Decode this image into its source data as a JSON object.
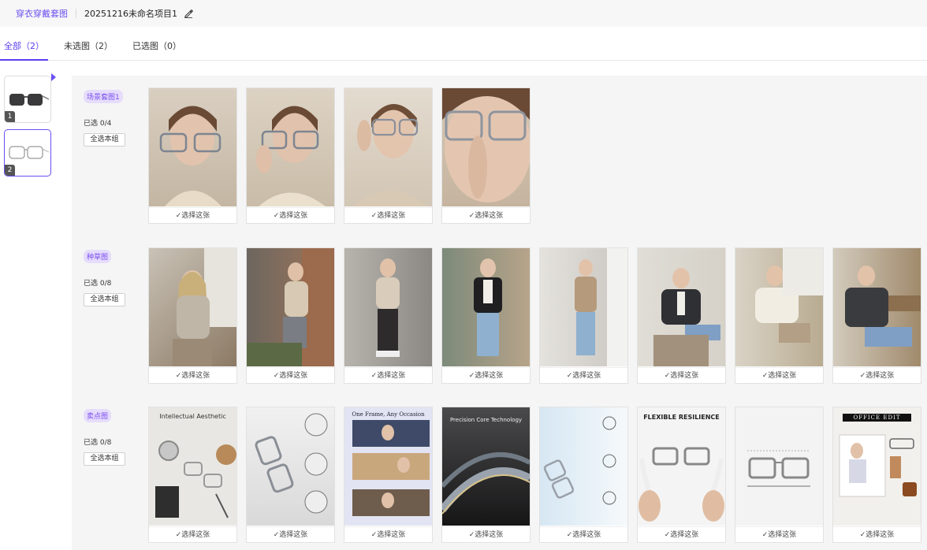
{
  "header": {
    "breadcrumb": "穿衣穿戴套图",
    "project_name": "20251216未命名项目1"
  },
  "tabs": [
    {
      "label": "全部（2）",
      "active": true
    },
    {
      "label": "未选图（2）",
      "active": false
    },
    {
      "label": "已选图（0）",
      "active": false
    }
  ],
  "sidebar": {
    "items": [
      {
        "num": "1"
      },
      {
        "num": "2"
      }
    ]
  },
  "select_label": "✓选择这张",
  "groups": [
    {
      "tag": "场景套图1",
      "count": "已选 0/4",
      "button": "全选本组",
      "cards": 4
    },
    {
      "tag": "种草图",
      "count": "已选 0/8",
      "button": "全选本组",
      "cards": 8
    },
    {
      "tag": "卖点图",
      "count": "已选 0/8",
      "button": "全选本组",
      "cards": 8,
      "overlays": [
        "Intellectual Aesthetic",
        "",
        "One Frame, Any Occasion",
        "Precision Core Technology",
        "",
        "FLEXIBLE RESILIENCE",
        "",
        "OFFICE EDIT"
      ]
    }
  ],
  "colors": {
    "accent": "#5b3cf0",
    "tag_bg": "#e6dcfb",
    "panel_bg": "#f5f5f6"
  }
}
